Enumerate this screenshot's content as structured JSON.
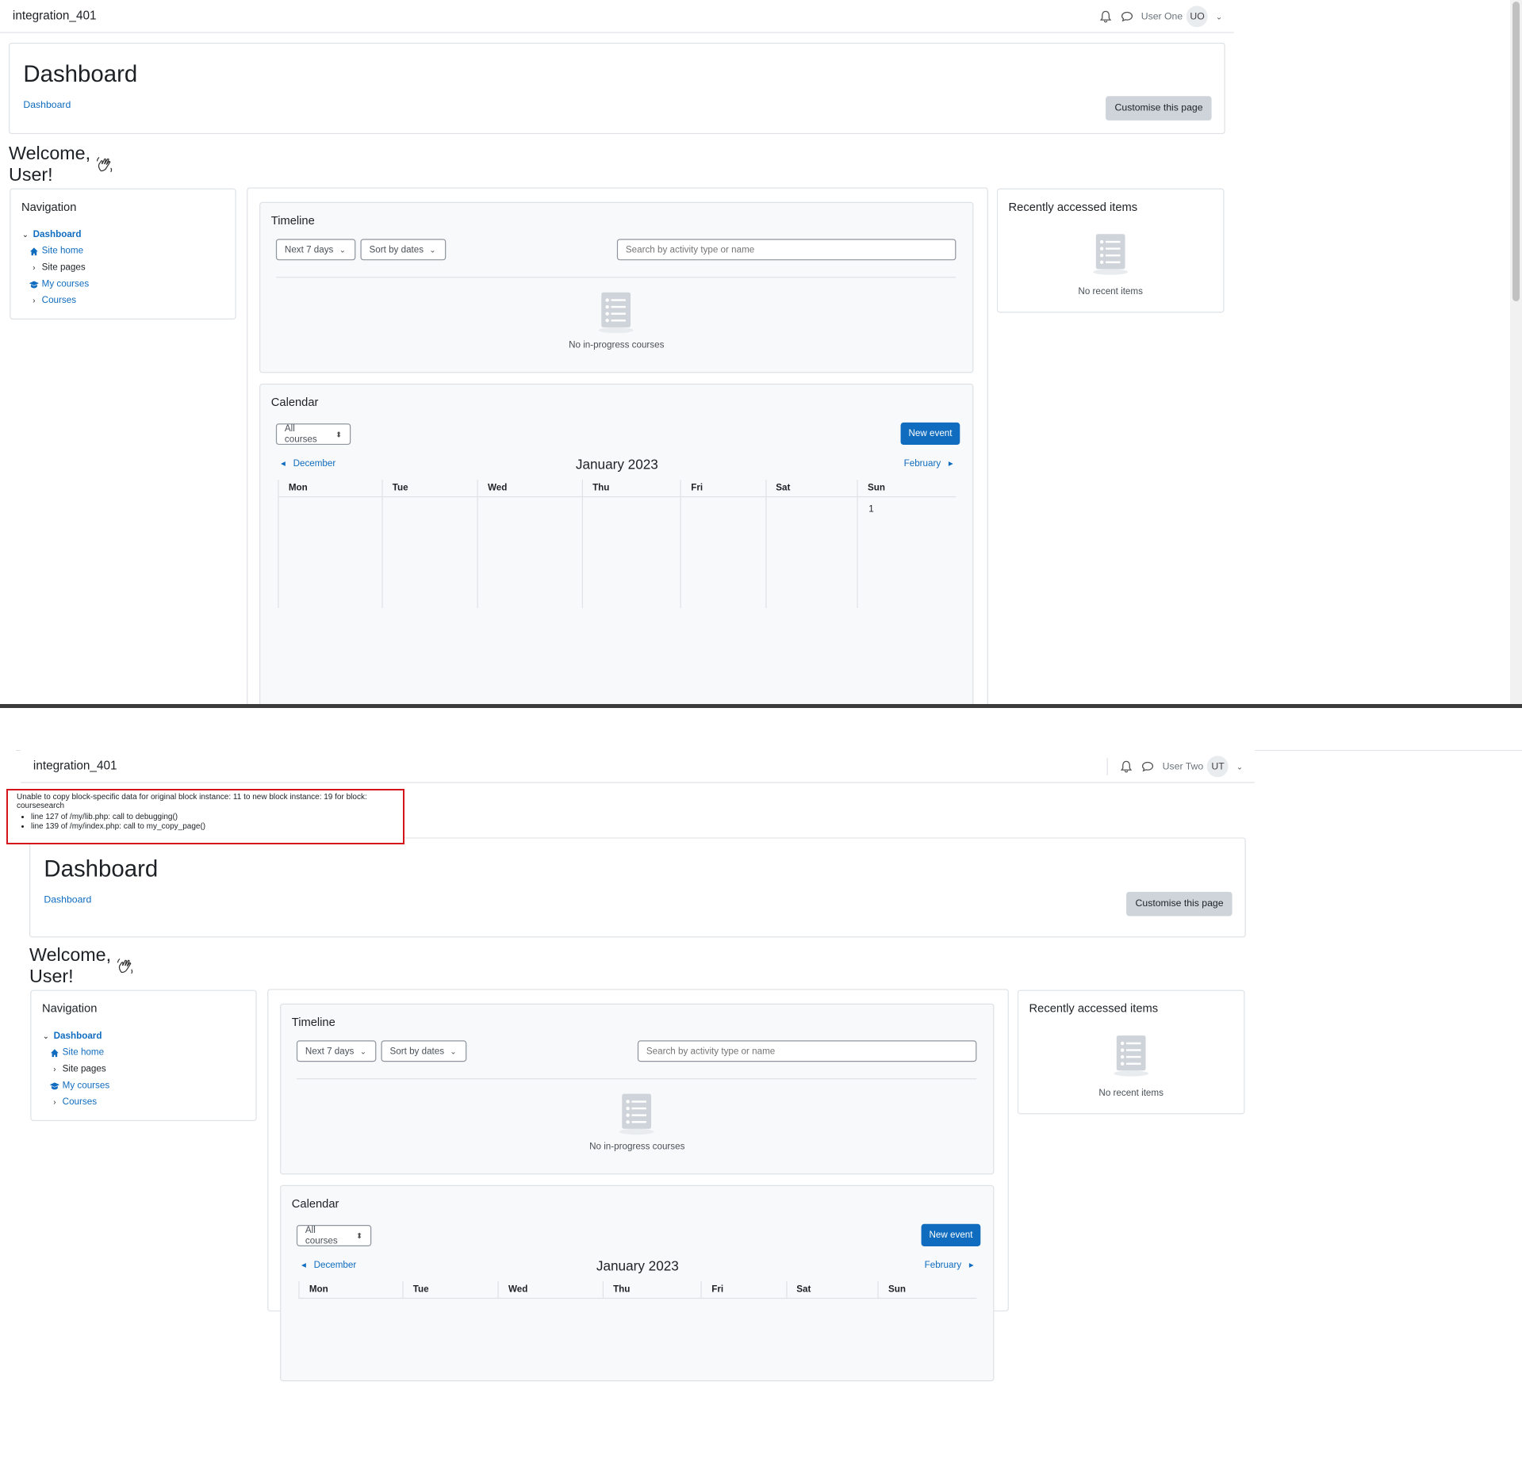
{
  "site": {
    "brand": "integration_401"
  },
  "screen1": {
    "user_name": "User One",
    "user_initials": "UO"
  },
  "screen2": {
    "user_name": "User Two",
    "user_initials": "UT",
    "debug": {
      "message": "Unable to copy block-specific data for original block instance: 11 to new block instance: 19 for block: coursesearch",
      "trace": [
        "line 127 of /my/lib.php: call to debugging()",
        "line 139 of /my/index.php: call to my_copy_page()"
      ]
    }
  },
  "header": {
    "title": "Dashboard",
    "breadcrumb": "Dashboard",
    "customise_button": "Customise this page"
  },
  "welcome": "Welcome, User!",
  "navigation": {
    "title": "Navigation",
    "items": [
      {
        "label": "Dashboard",
        "icon": "chevron-down-icon"
      },
      {
        "label": "Site home",
        "icon": "home-icon"
      },
      {
        "label": "Site pages",
        "icon": "chevron-right-icon"
      },
      {
        "label": "My courses",
        "icon": "graduation-cap-icon"
      },
      {
        "label": "Courses",
        "icon": "chevron-right-icon"
      }
    ]
  },
  "timeline": {
    "title": "Timeline",
    "filter": "Next 7 days",
    "sort": "Sort by dates",
    "search_placeholder": "Search by activity type or name",
    "empty": "No in-progress courses"
  },
  "calendar": {
    "title": "Calendar",
    "course_filter": "All courses",
    "new_event": "New event",
    "prev_month": "December",
    "current_month": "January 2023",
    "next_month": "February",
    "weekdays": [
      "Mon",
      "Tue",
      "Wed",
      "Thu",
      "Fri",
      "Sat",
      "Sun"
    ],
    "first_day": "1"
  },
  "recent": {
    "title": "Recently accessed items",
    "empty": "No recent items"
  },
  "colors": {
    "primary": "#0f6cbf",
    "debug_border": "#d3141b",
    "secondary_button": "#ced4da"
  }
}
